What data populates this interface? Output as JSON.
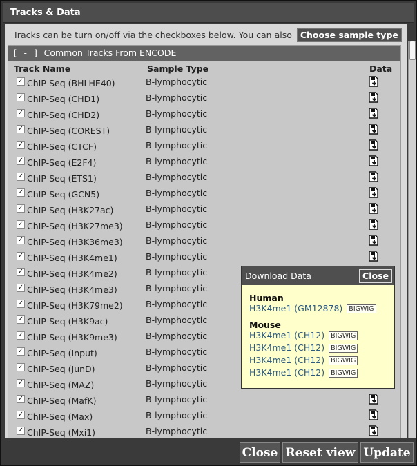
{
  "window": {
    "title": "Tracks & Data"
  },
  "intro": {
    "text": "Tracks can be turn on/off via the checkboxes below. You can also",
    "choose_sample_type": "Choose sample type"
  },
  "section": {
    "toggle": "[ - ]",
    "title": "Common Tracks From ENCODE",
    "columns": {
      "track_name": "Track Name",
      "sample_type": "Sample Type",
      "data": "Data"
    }
  },
  "tracks": [
    {
      "name": "ChIP-Seq (BHLHE40)",
      "sample": "B-lymphocytic",
      "checked": true
    },
    {
      "name": "ChIP-Seq (CHD1)",
      "sample": "B-lymphocytic",
      "checked": true
    },
    {
      "name": "ChIP-Seq (CHD2)",
      "sample": "B-lymphocytic",
      "checked": true
    },
    {
      "name": "ChIP-Seq (COREST)",
      "sample": "B-lymphocytic",
      "checked": true
    },
    {
      "name": "ChIP-Seq (CTCF)",
      "sample": "B-lymphocytic",
      "checked": true
    },
    {
      "name": "ChIP-Seq (E2F4)",
      "sample": "B-lymphocytic",
      "checked": true
    },
    {
      "name": "ChIP-Seq (ETS1)",
      "sample": "B-lymphocytic",
      "checked": true
    },
    {
      "name": "ChIP-Seq (GCN5)",
      "sample": "B-lymphocytic",
      "checked": true
    },
    {
      "name": "ChIP-Seq (H3K27ac)",
      "sample": "B-lymphocytic",
      "checked": true
    },
    {
      "name": "ChIP-Seq (H3K27me3)",
      "sample": "B-lymphocytic",
      "checked": true
    },
    {
      "name": "ChIP-Seq (H3K36me3)",
      "sample": "B-lymphocytic",
      "checked": true
    },
    {
      "name": "ChIP-Seq (H3K4me1)",
      "sample": "B-lymphocytic",
      "checked": true
    },
    {
      "name": "ChIP-Seq (H3K4me2)",
      "sample": "B-lymphocytic",
      "checked": true
    },
    {
      "name": "ChIP-Seq (H3K4me3)",
      "sample": "B-lymphocytic",
      "checked": true
    },
    {
      "name": "ChIP-Seq (H3K79me2)",
      "sample": "B-lymphocytic",
      "checked": true
    },
    {
      "name": "ChIP-Seq (H3K9ac)",
      "sample": "B-lymphocytic",
      "checked": true
    },
    {
      "name": "ChIP-Seq (H3K9me3)",
      "sample": "B-lymphocytic",
      "checked": true
    },
    {
      "name": "ChIP-Seq (Input)",
      "sample": "B-lymphocytic",
      "checked": true
    },
    {
      "name": "ChIP-Seq (JunD)",
      "sample": "B-lymphocytic",
      "checked": true
    },
    {
      "name": "ChIP-Seq (MAZ)",
      "sample": "B-lymphocytic",
      "checked": true
    },
    {
      "name": "ChIP-Seq (MafK)",
      "sample": "B-lymphocytic",
      "checked": true
    },
    {
      "name": "ChIP-Seq (Max)",
      "sample": "B-lymphocytic",
      "checked": true
    },
    {
      "name": "ChIP-Seq (Mxi1)",
      "sample": "B-lymphocytic",
      "checked": true
    }
  ],
  "download_popup": {
    "title": "Download Data",
    "close_label": "Close",
    "groups": [
      {
        "name": "Human",
        "items": [
          {
            "label": "H3K4me1 (GM12878)",
            "format": "BIGWIG"
          }
        ]
      },
      {
        "name": "Mouse",
        "items": [
          {
            "label": "H3K4me1 (CH12)",
            "format": "BIGWIG"
          },
          {
            "label": "H3K4me1 (CH12)",
            "format": "BIGWIG"
          },
          {
            "label": "H3K4me1 (CH12)",
            "format": "BIGWIG"
          },
          {
            "label": "H3K4me1 (CH12)",
            "format": "BIGWIG"
          }
        ]
      }
    ]
  },
  "footer": {
    "close": "Close",
    "reset_view": "Reset view",
    "update": "Update"
  },
  "colors": {
    "popup_bg": "#ffffcc",
    "link": "#2d5a80",
    "header_bg": "#4d4d4d"
  }
}
